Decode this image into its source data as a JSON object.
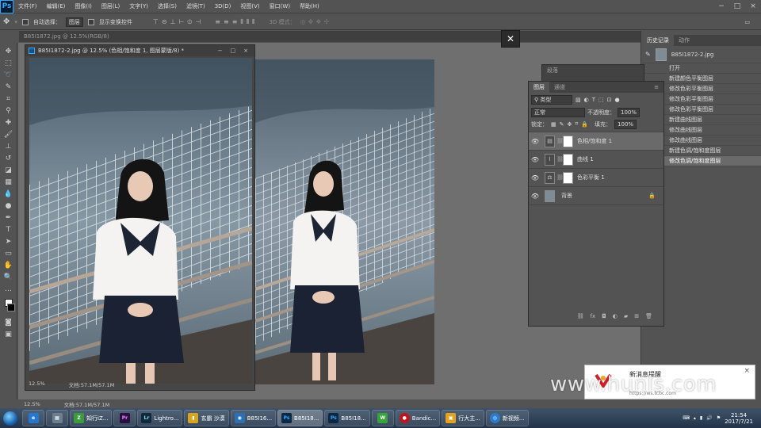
{
  "menubar": {
    "logo": "Ps",
    "items": [
      "文件(F)",
      "编辑(E)",
      "图像(I)",
      "图层(L)",
      "文字(Y)",
      "选择(S)",
      "滤镜(T)",
      "3D(D)",
      "视图(V)",
      "窗口(W)",
      "帮助(H)"
    ],
    "controls": [
      "−",
      "□",
      "×"
    ]
  },
  "options": {
    "auto_select_label": "自动选择：",
    "auto_select_value": "图层",
    "show_transform_label": "显示变换控件",
    "mode_3d_label": "3D 模式："
  },
  "tab": {
    "label": "B85I1872.jpg @ 12.5%(RGB/8)"
  },
  "float_window": {
    "title": "B85I1872-2.jpg @ 12.5% (色相/饱和度 1, 图层蒙版/8) *",
    "zoom": "12.5%",
    "doc_size": "文档:57.1M/57.1M"
  },
  "status": {
    "zoom": "12.5%",
    "doc_size": "文档:57.1M/57.1M"
  },
  "history": {
    "tabs": [
      "历史记录",
      "动作"
    ],
    "snapshot": "B85I1872-2.jpg",
    "items": [
      "打开",
      "新建颜色平衡图层",
      "修改色彩平衡图层",
      "修改色彩平衡图层",
      "修改色彩平衡图层",
      "新建曲线图层",
      "修改曲线图层",
      "修改曲线图层",
      "新建色调/饱和度图层",
      "修改色调/饱和度图层"
    ],
    "active_index": 9
  },
  "collapsed_panel": {
    "label": "段落"
  },
  "layers": {
    "tabs": [
      "图层",
      "通道"
    ],
    "filter_label": "类型",
    "blend_mode": "正常",
    "opacity_label": "不透明度：",
    "opacity_value": "100%",
    "lock_label": "锁定：",
    "fill_label": "填充：",
    "fill_value": "100%",
    "rows": [
      {
        "name": "色相/饱和度 1",
        "active": true
      },
      {
        "name": "曲线 1",
        "active": false
      },
      {
        "name": "色彩平衡 1",
        "active": false
      },
      {
        "name": "背景",
        "active": false
      }
    ]
  },
  "notification": {
    "title": "新消息提醒",
    "url": "https://ws.tcbc.com",
    "close": "×"
  },
  "watermark": "www.hunls.com",
  "taskbar": {
    "tasks": [
      {
        "label": "知行iZ...",
        "icon": "Z",
        "color": "#3a9b3a"
      },
      {
        "label": "",
        "icon": "Pr",
        "color": "#2a0f40"
      },
      {
        "label": "Lightro...",
        "icon": "Lr",
        "color": "#0f2a3a"
      },
      {
        "label": "玄霸 沙漠",
        "icon": "▮",
        "color": "#d9a520"
      },
      {
        "label": "B85I16...",
        "icon": "◉",
        "color": "#2d6fb3"
      },
      {
        "label": "B85I18...",
        "icon": "Ps",
        "color": "#0b2945"
      },
      {
        "label": "B85I18...",
        "icon": "Ps",
        "color": "#0b2945"
      },
      {
        "label": "",
        "icon": "W",
        "color": "#36a43a"
      },
      {
        "label": "Bandic...",
        "icon": "●",
        "color": "#c0151a"
      },
      {
        "label": "行大主...",
        "icon": "▣",
        "color": "#e2a322"
      },
      {
        "label": "新视频...",
        "icon": "◎",
        "color": "#2a7ccf"
      }
    ],
    "clock_time": "21:54",
    "clock_date": "2017/7/21"
  }
}
